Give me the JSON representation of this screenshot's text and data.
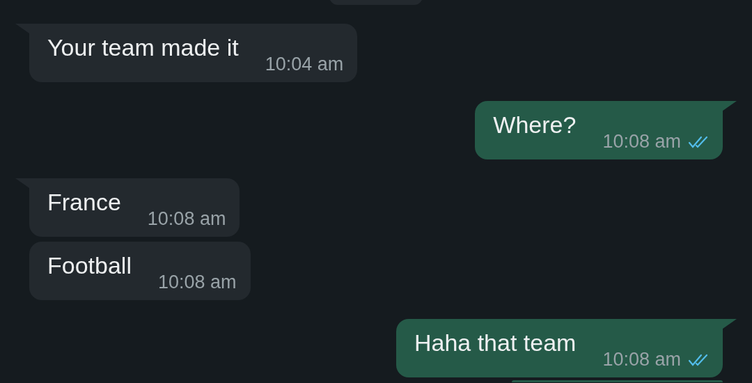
{
  "messages": [
    {
      "kind": "date-chip-cut"
    },
    {
      "kind": "message",
      "outgoing": false,
      "tail": true,
      "text": "Your team made it",
      "time": "10:04 am"
    },
    {
      "kind": "message",
      "outgoing": true,
      "tail": true,
      "text": "Where?",
      "time": "10:08 am",
      "read": true
    },
    {
      "kind": "message",
      "outgoing": false,
      "tail": true,
      "text": "France",
      "time": "10:08 am"
    },
    {
      "kind": "message",
      "outgoing": false,
      "tail": false,
      "text": "Football",
      "time": "10:08 am"
    },
    {
      "kind": "message",
      "outgoing": true,
      "tail": true,
      "text": "Haha that team",
      "time": "10:08 am",
      "read": true
    },
    {
      "kind": "bubble-cut",
      "outgoing": true
    }
  ]
}
